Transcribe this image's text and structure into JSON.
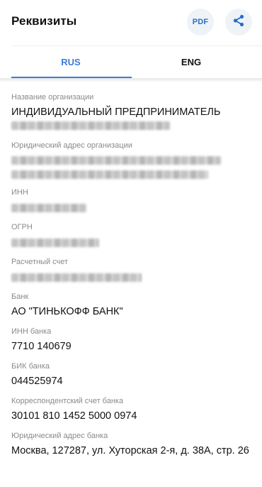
{
  "header": {
    "title": "Реквизиты",
    "pdf_label": "PDF"
  },
  "tabs": [
    {
      "label": "RUS",
      "active": true
    },
    {
      "label": "ENG",
      "active": false
    }
  ],
  "colors": {
    "accent": "#3b7dd8",
    "label_gray": "#8a8a8a",
    "button_bg": "#eef3f8"
  },
  "icons": {
    "share": "share-icon"
  },
  "fields": {
    "org_name": {
      "label": "Название организации",
      "value": "ИНДИВИДУАЛЬНЫЙ ПРЕДПРИНИМАТЕЛЬ"
    },
    "legal_address": {
      "label": "Юридический адрес организации"
    },
    "inn": {
      "label": "ИНН"
    },
    "ogrn": {
      "label": "ОГРН"
    },
    "account": {
      "label": "Расчетный счет"
    },
    "bank": {
      "label": "Банк",
      "value": "АО \"ТИНЬКОФФ БАНК\""
    },
    "bank_inn": {
      "label": "ИНН банка",
      "value": "7710 140679"
    },
    "bik": {
      "label": "БИК банка",
      "value": "044525974"
    },
    "corr_account": {
      "label": "Корреспондентский счет банка",
      "value": "30101 810 1452 5000 0974"
    },
    "bank_address": {
      "label": "Юридический адрес банка",
      "value": "Москва, 127287, ул. Хуторская 2-я, д. 38А, стр. 26"
    }
  }
}
